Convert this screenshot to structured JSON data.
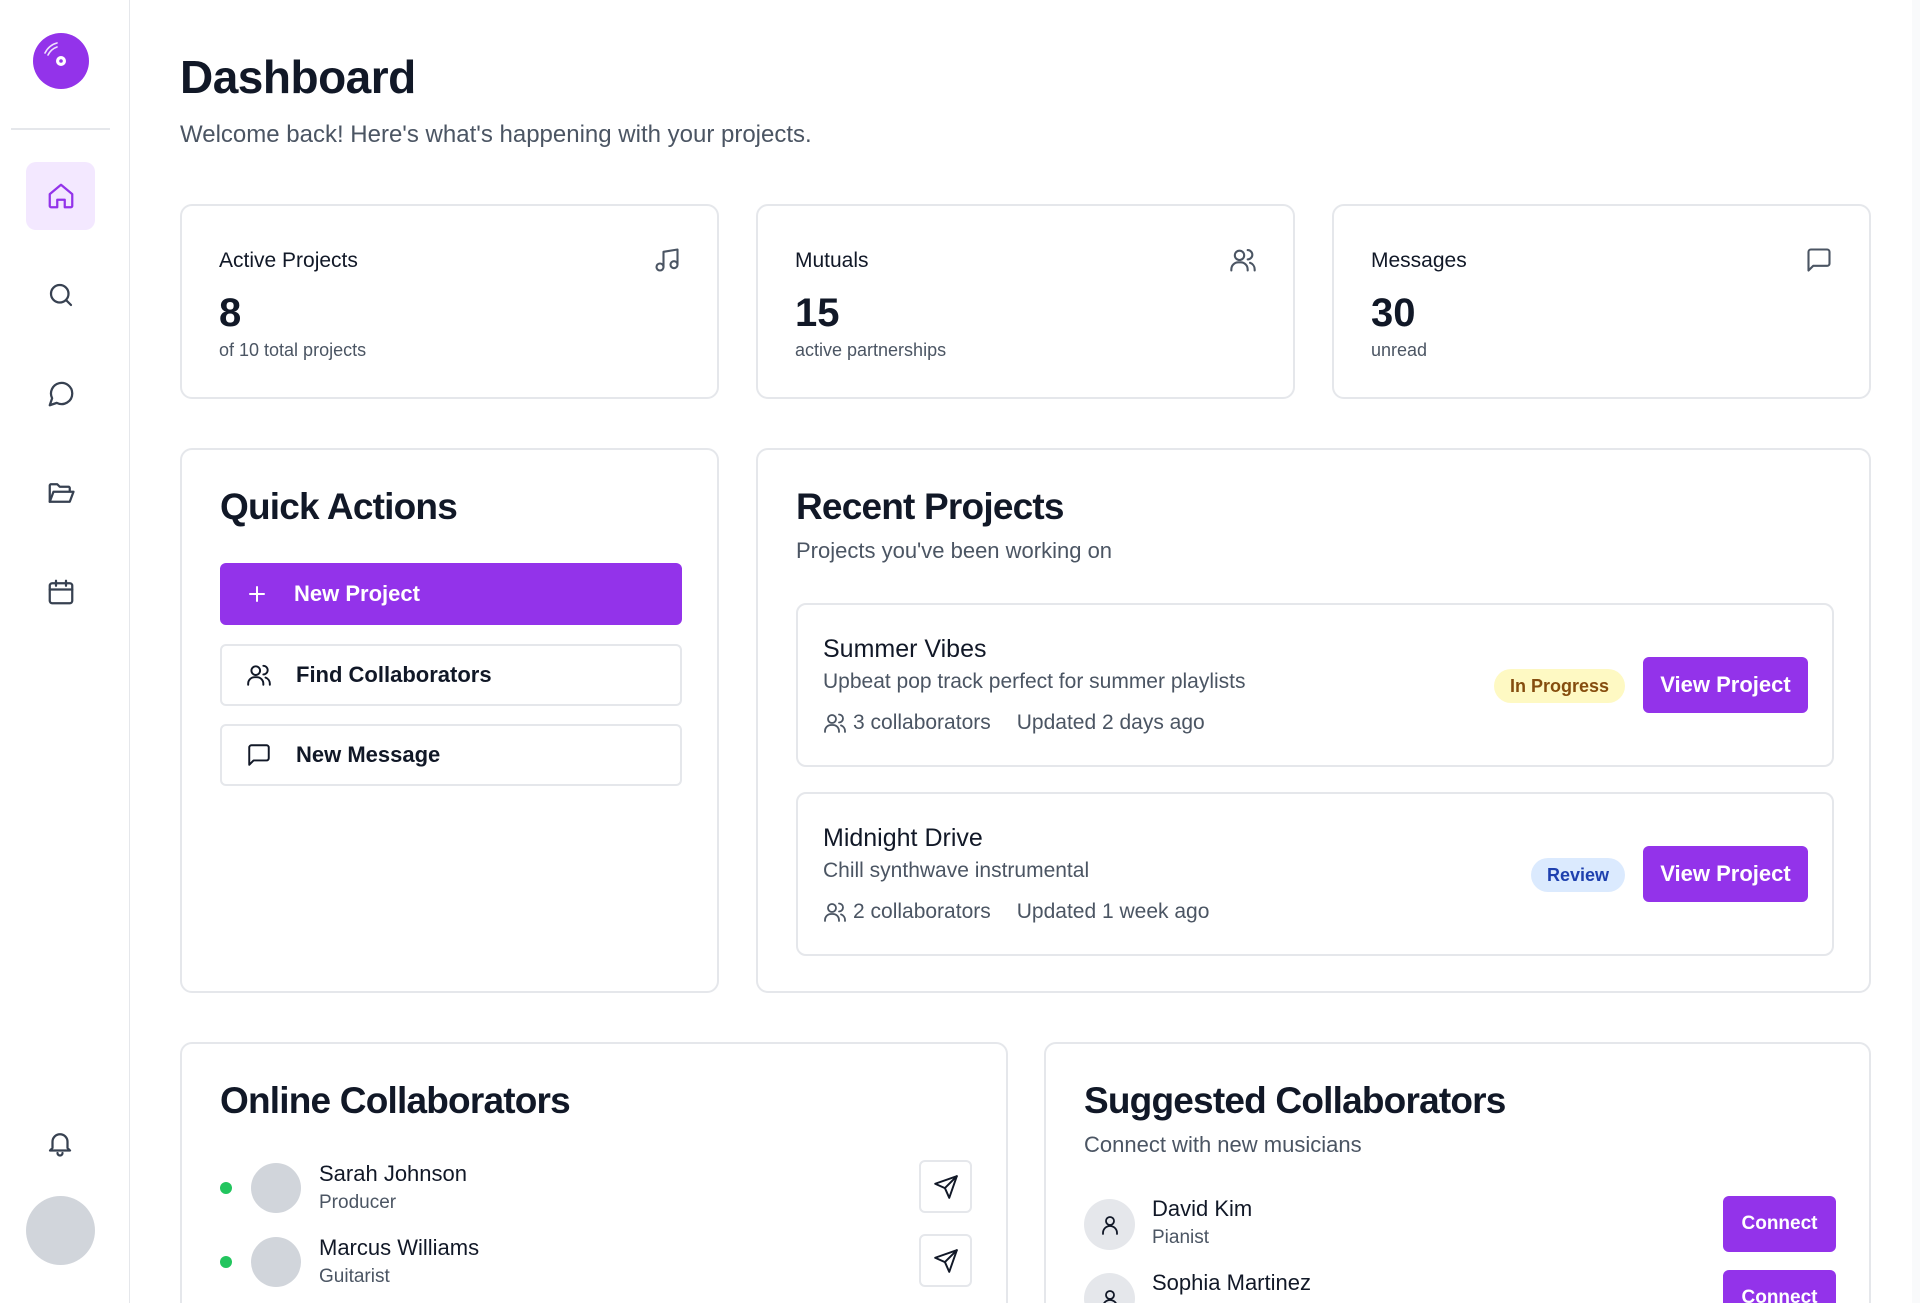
{
  "colors": {
    "accent": "#9333ea",
    "accent_light": "#f3e8ff",
    "online": "#22c55e"
  },
  "sidebar": {
    "items": [
      {
        "icon": "home-icon",
        "active": true
      },
      {
        "icon": "search-icon",
        "active": false
      },
      {
        "icon": "message-circle-icon",
        "active": false
      },
      {
        "icon": "folder-open-icon",
        "active": false
      },
      {
        "icon": "calendar-icon",
        "active": false
      }
    ],
    "bottom": [
      {
        "icon": "bell-icon"
      }
    ]
  },
  "header": {
    "title": "Dashboard",
    "subtitle": "Welcome back! Here's what's happening with your projects."
  },
  "stats": [
    {
      "label": "Active Projects",
      "value": "8",
      "sub": "of 10 total projects",
      "icon": "music-icon"
    },
    {
      "label": "Mutuals",
      "value": "15",
      "sub": "active partnerships",
      "icon": "users-icon"
    },
    {
      "label": "Messages",
      "value": "30",
      "sub": "unread",
      "icon": "message-square-icon"
    }
  ],
  "quick_actions": {
    "title": "Quick Actions",
    "buttons": [
      {
        "label": "New Project",
        "icon": "plus-icon"
      },
      {
        "label": "Find Collaborators",
        "icon": "users-icon"
      },
      {
        "label": "New Message",
        "icon": "message-square-icon"
      }
    ]
  },
  "recent_projects": {
    "title": "Recent Projects",
    "subtitle": "Projects you've been working on",
    "items": [
      {
        "name": "Summer Vibes",
        "description": "Upbeat pop track perfect for summer playlists",
        "collaborators": "3 collaborators",
        "updated": "Updated 2 days ago",
        "status": "In Progress",
        "action": "View Project"
      },
      {
        "name": "Midnight Drive",
        "description": "Chill synthwave instrumental",
        "collaborators": "2 collaborators",
        "updated": "Updated 1 week ago",
        "status": "Review",
        "action": "View Project"
      }
    ]
  },
  "online_collaborators": {
    "title": "Online Collaborators",
    "items": [
      {
        "name": "Sarah Johnson",
        "role": "Producer"
      },
      {
        "name": "Marcus Williams",
        "role": "Guitarist"
      }
    ]
  },
  "suggested_collaborators": {
    "title": "Suggested Collaborators",
    "subtitle": "Connect with new musicians",
    "items": [
      {
        "name": "David Kim",
        "role": "Pianist",
        "action": "Connect"
      },
      {
        "name": "Sophia Martinez",
        "role": "",
        "action": "Connect"
      }
    ]
  }
}
